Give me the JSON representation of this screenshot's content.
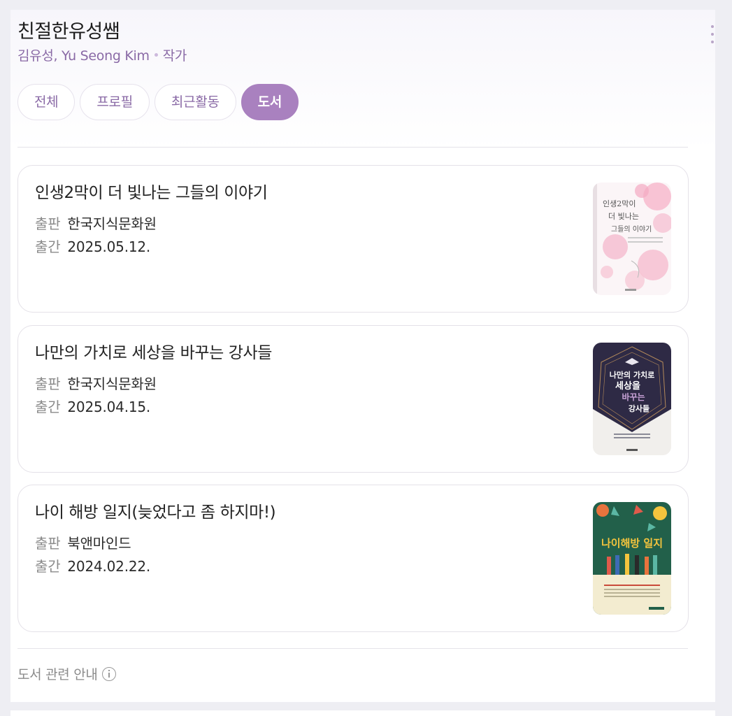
{
  "profile": {
    "name": "친절한유성쌤",
    "full_name": "김유성, Yu Seong Kim",
    "role": "작가"
  },
  "tabs": [
    {
      "label": "전체",
      "active": false
    },
    {
      "label": "프로필",
      "active": false
    },
    {
      "label": "최근활동",
      "active": false
    },
    {
      "label": "도서",
      "active": true
    }
  ],
  "labels": {
    "publisher": "출판",
    "published": "출간"
  },
  "books": [
    {
      "title": "인생2막이 더 빛나는 그들의 이야기",
      "publisher": "한국지식문화원",
      "date": "2025.05.12.",
      "cover": {
        "title_lines": [
          "인생2막이",
          "더 빛나는",
          "그들의 이야기"
        ],
        "background": "#fbf5f7",
        "accent": "#f3a9c2"
      }
    },
    {
      "title": "나만의 가치로 세상을 바꾸는 강사들",
      "publisher": "한국지식문화원",
      "date": "2025.04.15.",
      "cover": {
        "title_lines": [
          "나만의 가치로",
          "세상을",
          "바꾸는",
          "강사들"
        ],
        "background": "#2e2a45",
        "accent": "#b48a5a"
      }
    },
    {
      "title": "나이 해방 일지(늦었다고 좀 하지마!)",
      "publisher": "북앤마인드",
      "date": "2024.02.22.",
      "cover": {
        "title_lines": [
          "나이해방 일지"
        ],
        "background": "#22604a",
        "accent": "#f4c43d"
      }
    }
  ],
  "footer": {
    "label": "도서 관련 안내",
    "icon": "info-icon"
  },
  "colors": {
    "accent": "#a981bf",
    "accent_text": "#8a6aa6"
  }
}
